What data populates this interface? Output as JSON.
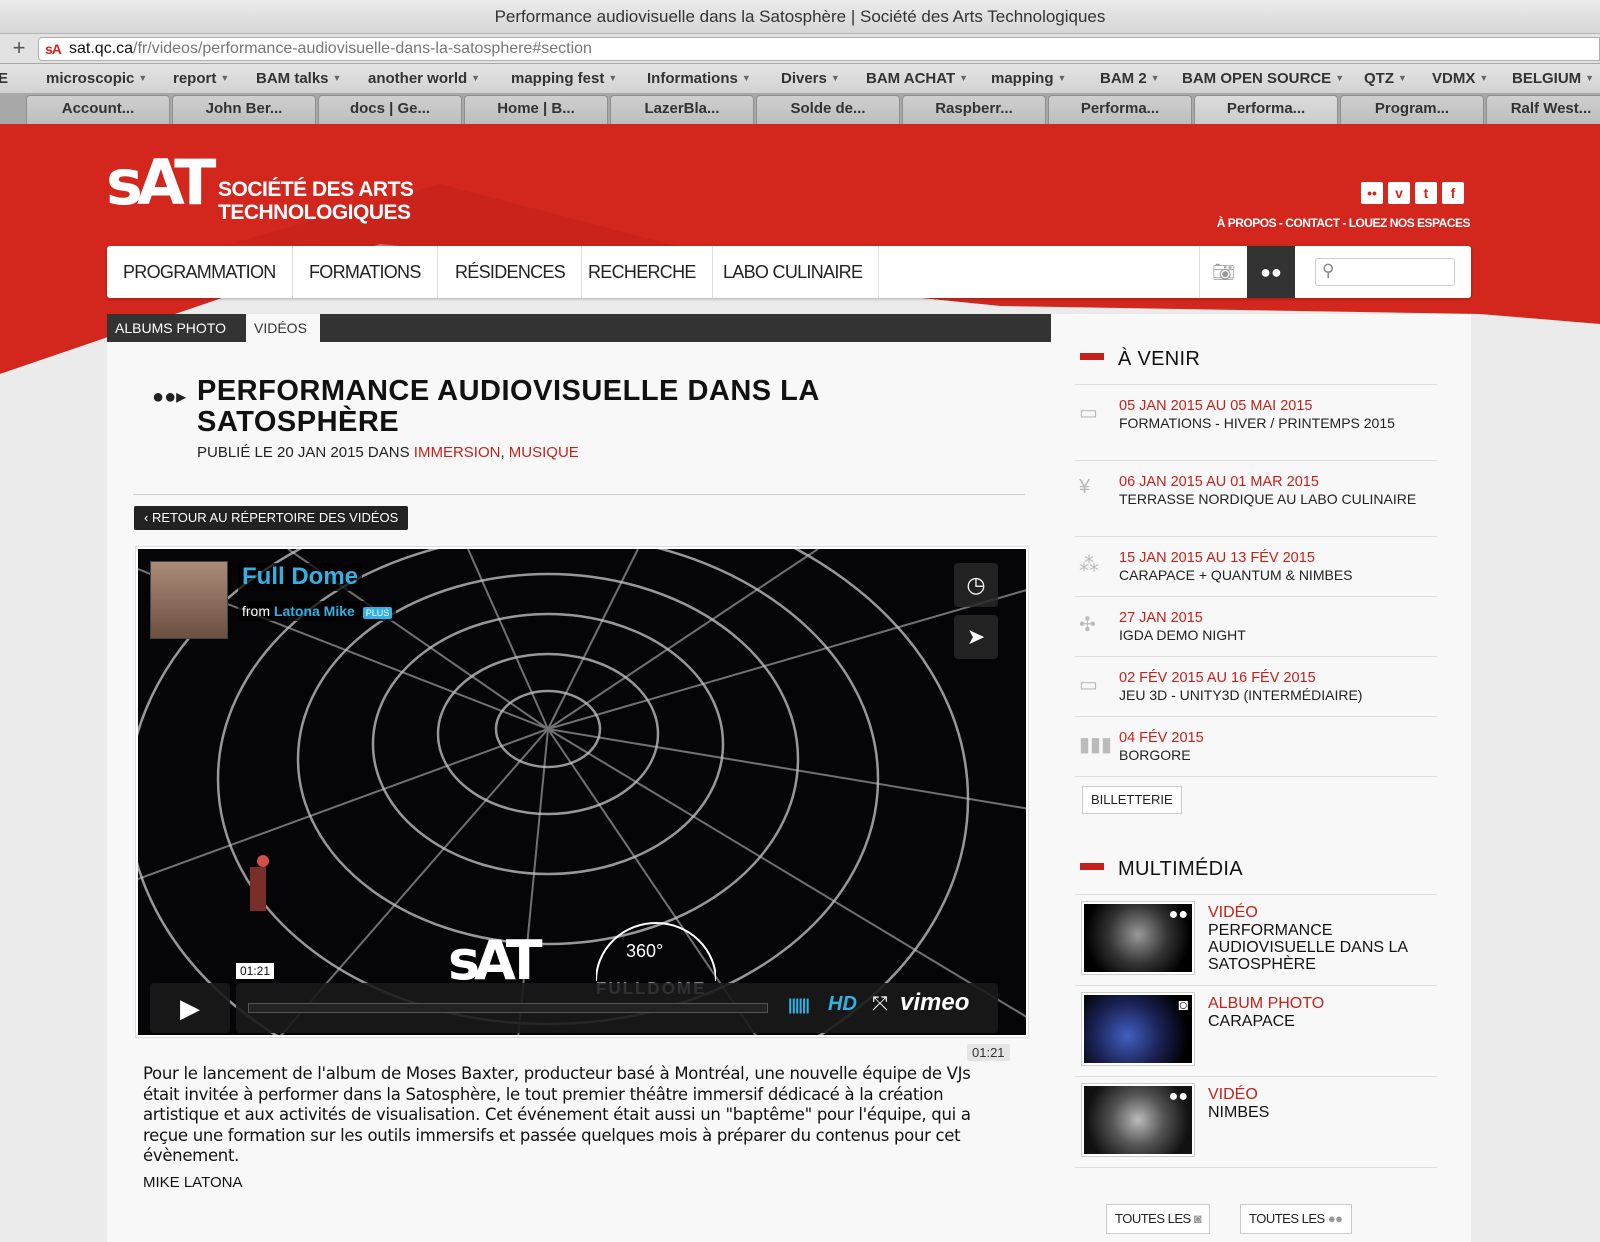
{
  "browser": {
    "window_title": "Performance audiovisuelle dans la Satosphère | Société des Arts Technologiques",
    "url_host": "sat.qc.ca",
    "url_path": "/fr/videos/performance-audiovisuelle-dans-la-satosphere#section",
    "bookmarks": [
      "E",
      "microscopic",
      "report",
      "BAM talks",
      "another world",
      "mapping fest",
      "Informations",
      "Divers",
      "BAM ACHAT",
      "mapping",
      "BAM 2",
      "BAM OPEN SOURCE",
      "QTZ",
      "VDMX",
      "BELGIUM"
    ],
    "tabs": [
      "Account...",
      "John Ber...",
      "docs | Ge...",
      "Home | B...",
      "LazerBla...",
      "Solde de...",
      "Raspberr...",
      "Performa...",
      "Performa...",
      "Program...",
      "Ralf West..."
    ]
  },
  "site": {
    "logo_mark": "sAT",
    "logo_name_line1": "SOCIÉTÉ DES ARTS",
    "logo_name_line2": "TECHNOLOGIQUES",
    "toplinks": "À PROPOS - CONTACT - LOUEZ NOS ESPACES",
    "nav": [
      "PROGRAMMATION",
      "FORMATIONS",
      "RÉSIDENCES",
      "RECHERCHE",
      "LABO CULINAIRE"
    ],
    "subnav": [
      "ALBUMS PHOTO",
      "VIDÉOS"
    ]
  },
  "article": {
    "title": "PERFORMANCE AUDIOVISUELLE DANS LA SATOSPHÈRE",
    "meta_prefix": "PUBLIÉ LE 20 JAN 2015 DANS",
    "tag1": "IMMERSION",
    "separator": ",",
    "tag2": "MUSIQUE",
    "back_button": "RETOUR AU RÉPERTOIRE DES VIDÉOS",
    "duration": "01:21",
    "description": "Pour le lancement de l'album de Moses Baxter, producteur basé à Montréal, une nouvelle équipe de VJs était invitée à performer dans la Satosphère, le tout premier théâtre immersif dédicacé à la création artistique et aux activités de visualisation. Cet événement était aussi un \"baptême\" pour l'équipe, qui a reçue une formation sur les outils immersifs et passée quelques mois à préparer du contenus pour cet évènement.",
    "credit": "MIKE LATONA"
  },
  "video": {
    "title": "Full Dome",
    "from_label": "from",
    "author": "Latona Mike",
    "badge": "PLUS",
    "time_tip": "01:21",
    "hd": "HD",
    "brand": "vimeo",
    "watermark": "sAT",
    "dome_label": "360°",
    "dome_text": "FULLDOME",
    "progress": 0
  },
  "sidebar": {
    "upcoming_title": "À VENIR",
    "events": [
      {
        "date": "05 JAN 2015 AU 05 MAI 2015",
        "title": "FORMATIONS - HIVER / PRINTEMPS 2015",
        "icon": "laptop-icon"
      },
      {
        "date": "06 JAN 2015 AU 01 MAR 2015",
        "title": "TERRASSE NORDIQUE AU LABO CULINAIRE",
        "icon": "cutlery-icon"
      },
      {
        "date": "15 JAN 2015 AU 13 FÉV 2015",
        "title": "CARAPACE + QUANTUM & NIMBES",
        "icon": "molecule-icon"
      },
      {
        "date": "27 JAN 2015",
        "title": "IGDA DEMO NIGHT",
        "icon": "network-icon"
      },
      {
        "date": "02 FÉV 2015 AU 16 FÉV 2015",
        "title": "JEU 3D - UNITY3D (INTERMÉDIAIRE)",
        "icon": "laptop-icon"
      },
      {
        "date": "04 FÉV 2015",
        "title": "BORGORE",
        "icon": "equalizer-icon"
      }
    ],
    "tickets": "BILLETTERIE",
    "multimedia_title": "MULTIMÉDIA",
    "multimedia": [
      {
        "kind": "VIDÉO",
        "title": "PERFORMANCE AUDIOVISUELLE DANS LA SATOSPHÈRE",
        "icon": "video-camera-icon"
      },
      {
        "kind": "ALBUM PHOTO",
        "title": "CARAPACE",
        "icon": "camera-icon"
      },
      {
        "kind": "VIDÉO",
        "title": "NIMBES",
        "icon": "video-camera-icon"
      }
    ],
    "all_photos": "TOUTES LES",
    "all_videos": "TOUTES LES"
  },
  "colors": {
    "brand_red": "#d3271d",
    "link_red": "#c3221b",
    "vimeo_blue": "#34b1e4"
  }
}
